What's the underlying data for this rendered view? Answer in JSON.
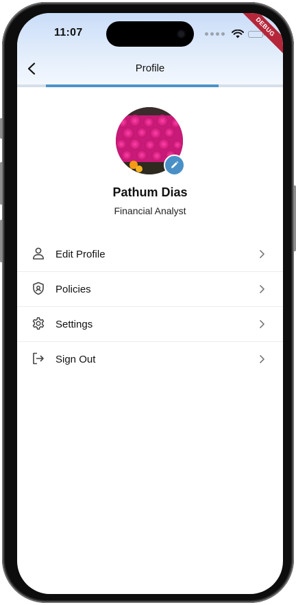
{
  "status_bar": {
    "time": "11:07"
  },
  "debug_banner": "DEBUG",
  "header": {
    "title": "Profile"
  },
  "progress": {
    "fraction": 0.65
  },
  "profile": {
    "name": "Pathum Dias",
    "job_title": "Financial Analyst",
    "avatar_icon": "flower-photo",
    "edit_icon": "pencil-icon"
  },
  "menu": [
    {
      "label": "Edit Profile",
      "icon": "person-icon"
    },
    {
      "label": "Policies",
      "icon": "shield-icon"
    },
    {
      "label": "Settings",
      "icon": "gear-icon"
    },
    {
      "label": "Sign Out",
      "icon": "logout-icon"
    }
  ],
  "colors": {
    "accent": "#4a93c8",
    "header_gradient_top": "#c9dcf8",
    "debug": "#b5263a"
  }
}
